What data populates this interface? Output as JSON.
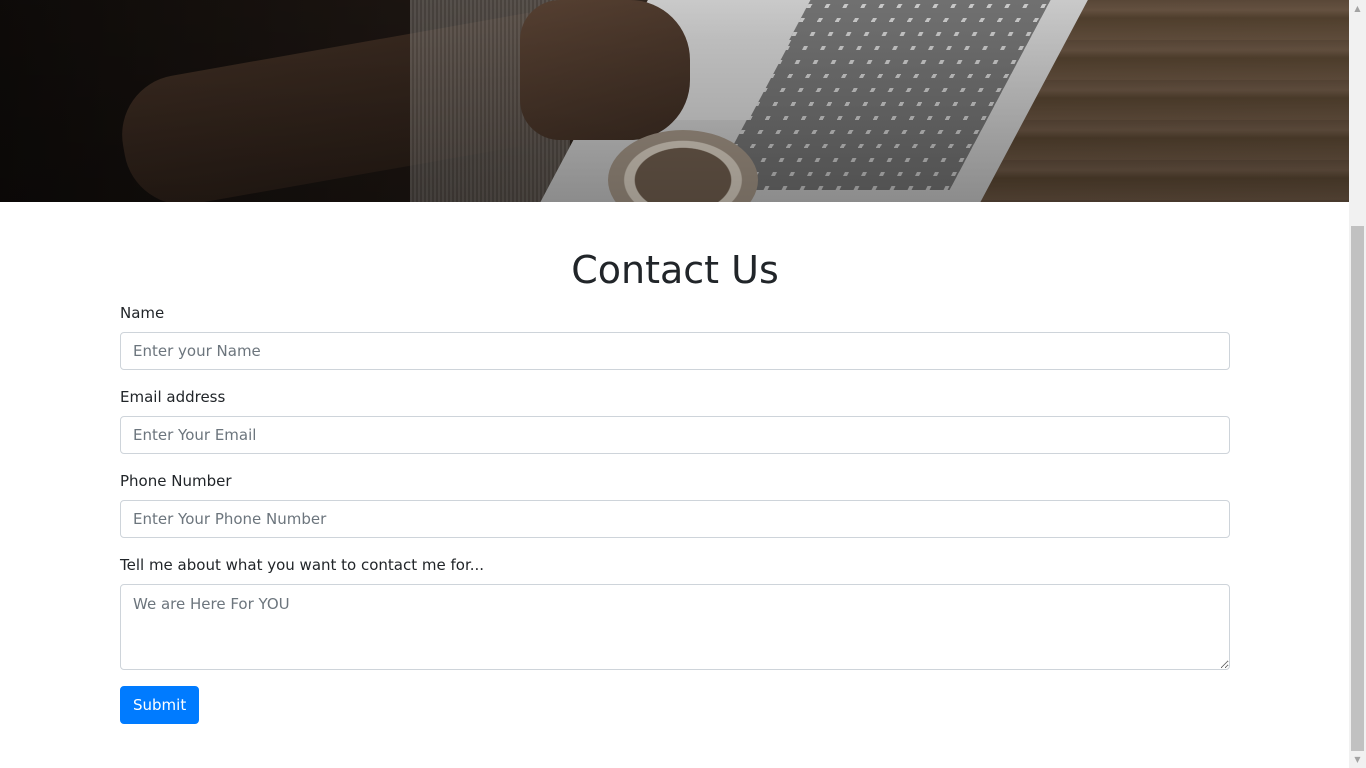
{
  "hero": {
    "image_alt": "Person typing on laptop beside coffee cup"
  },
  "page": {
    "title": "Contact Us"
  },
  "form": {
    "name": {
      "label": "Name",
      "placeholder": "Enter your Name"
    },
    "email": {
      "label": "Email address",
      "placeholder": "Enter Your Email"
    },
    "phone": {
      "label": "Phone Number",
      "placeholder": "Enter Your Phone Number"
    },
    "message": {
      "label": "Tell me about what you want to contact me for...",
      "placeholder": "We are Here For YOU"
    },
    "submit_label": "Submit"
  },
  "colors": {
    "primary": "#007bff",
    "text": "#212529",
    "border": "#ced4da"
  }
}
